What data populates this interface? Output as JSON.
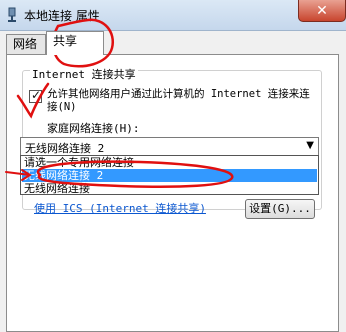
{
  "window": {
    "title": "本地连接 属性",
    "close_label": "✕"
  },
  "tabs": [
    {
      "label": "网络"
    },
    {
      "label": "共享"
    }
  ],
  "sharing": {
    "group_title": "Internet 连接共享",
    "allow_checkbox": {
      "checked": true,
      "label": "允许其他网络用户通过此计算机的 Internet 连接来连接(N)"
    },
    "home_network_label": "家庭网络连接(H):",
    "home_network_select": {
      "value": "无线网络连接 2",
      "options": [
        "请选一个专用网络连接",
        "无线网络连接 2",
        "无线网络连接"
      ]
    },
    "ics_link": "使用 ICS (Internet 连接共享)",
    "settings_button": "设置(G)..."
  },
  "colors": {
    "annotation": "#e01010",
    "selection": "#3399ff"
  }
}
